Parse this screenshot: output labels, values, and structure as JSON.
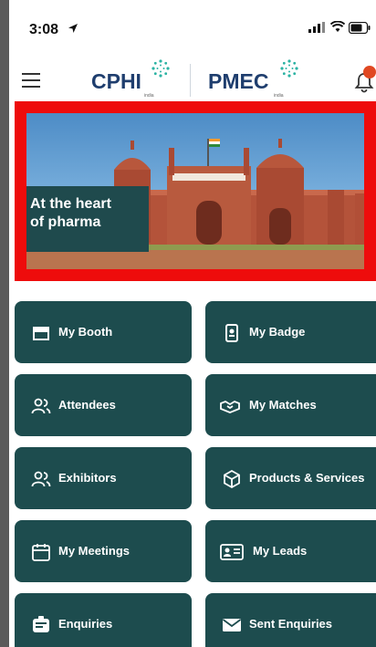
{
  "status_bar": {
    "time": "3:08"
  },
  "header": {
    "logo_left": "CPHI",
    "logo_right": "PMEC",
    "logo_sub": "india"
  },
  "banner": {
    "line1": "At the heart",
    "line2": "of pharma"
  },
  "menu": [
    {
      "label": "My Booth",
      "icon": "booth-icon"
    },
    {
      "label": "My Badge",
      "icon": "badge-icon"
    },
    {
      "label": "Attendees",
      "icon": "people-icon"
    },
    {
      "label": "My Matches",
      "icon": "handshake-icon"
    },
    {
      "label": "Exhibitors",
      "icon": "people-icon"
    },
    {
      "label": "Products & Services",
      "icon": "cube-icon"
    },
    {
      "label": "My Meetings",
      "icon": "calendar-icon"
    },
    {
      "label": "My Leads",
      "icon": "id-card-icon"
    },
    {
      "label": "Enquiries",
      "icon": "enquiry-icon"
    },
    {
      "label": "Sent Enquiries",
      "icon": "envelope-icon"
    }
  ],
  "colors": {
    "tile": "#1d4c4e",
    "highlight": "#ee0c0c",
    "logo": "#1f3e6e",
    "notification": "#e04822"
  }
}
